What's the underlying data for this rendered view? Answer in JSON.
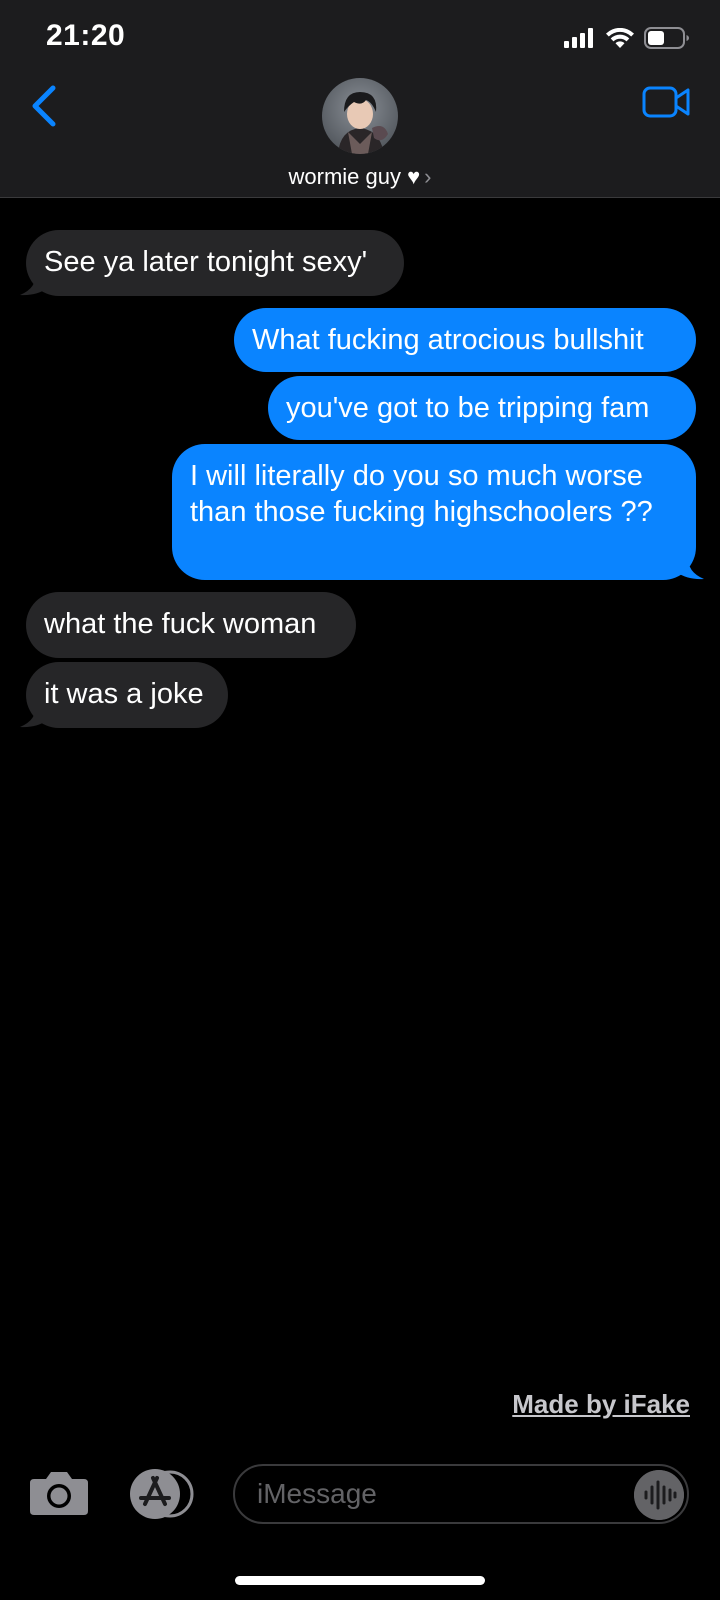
{
  "status_bar": {
    "time": "21:20",
    "icons": [
      "cellular-signal-icon",
      "wifi-icon",
      "battery-icon"
    ]
  },
  "header": {
    "contact_name": "wormie guy ♥",
    "chevron": "›",
    "back_icon": "chevron-left-icon",
    "video_icon": "video-camera-icon"
  },
  "messages": [
    {
      "direction": "received",
      "text": "See ya later tonight sexy'"
    },
    {
      "direction": "sent",
      "text": "What fucking atrocious bullshit"
    },
    {
      "direction": "sent",
      "text": "you've got to be tripping fam"
    },
    {
      "direction": "sent",
      "text": "I will literally do you so much worse than those fucking highschoolers ??"
    },
    {
      "direction": "received",
      "text": "what the fuck woman"
    },
    {
      "direction": "received",
      "text": "it was a joke"
    }
  ],
  "footer": {
    "watermark": "Made by iFake",
    "input_placeholder": "iMessage"
  },
  "colors": {
    "sent_bubble": "#0a84ff",
    "received_bubble": "#262628",
    "accent": "#0a84ff",
    "header_bg": "#1c1c1e",
    "background": "#000000"
  }
}
